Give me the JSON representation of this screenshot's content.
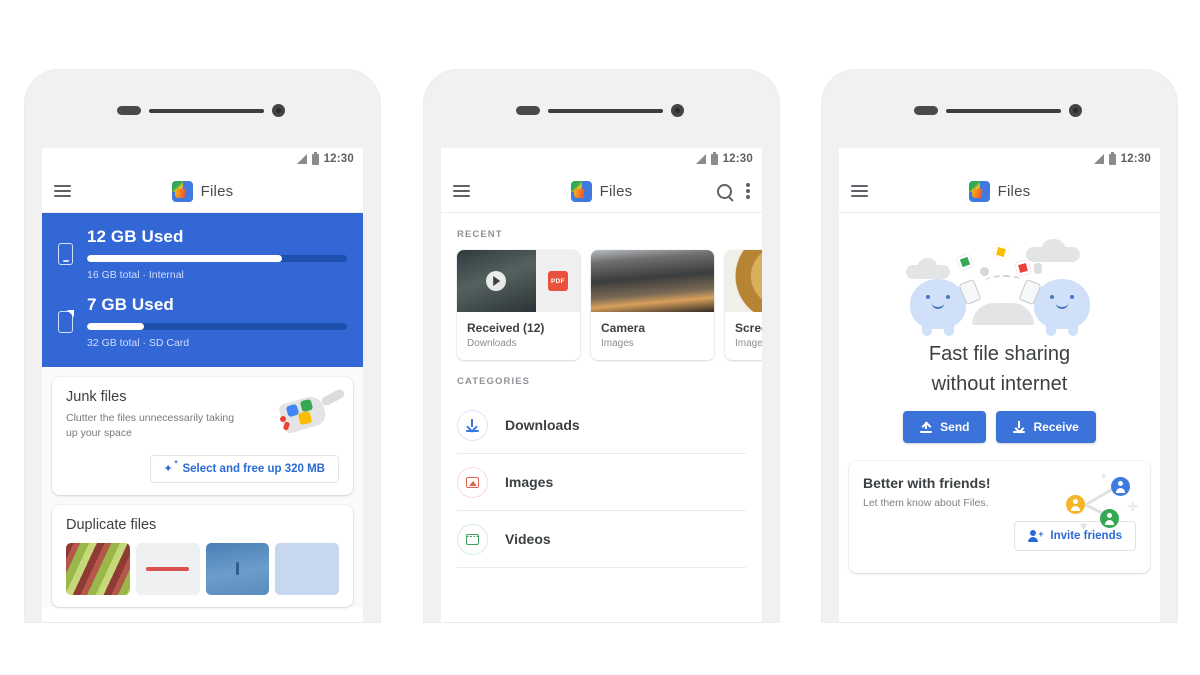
{
  "status_bar": {
    "time": "12:30",
    "signal_icon": "signal-icon",
    "battery_icon": "battery-icon"
  },
  "app": {
    "name": "Files",
    "logo_icon": "files-logo-icon",
    "menu_icon": "hamburger-menu-icon"
  },
  "colors": {
    "primary_blue": "#3367d6",
    "button_blue": "#3b73db",
    "link_blue": "#2b6ad4",
    "track_blue": "#1f4fad"
  },
  "screen1": {
    "storage": [
      {
        "icon": "phone-storage-icon",
        "title": "12 GB Used",
        "subtitle": "16 GB total · Internal",
        "used_gb": 12,
        "total_gb": 16,
        "percent": 75
      },
      {
        "icon": "sd-card-icon",
        "title": "7 GB Used",
        "subtitle": "32 GB total · SD Card",
        "used_gb": 7,
        "total_gb": 32,
        "percent": 22
      }
    ],
    "junk_card": {
      "title": "Junk files",
      "description": "Clutter the files unnecessarily taking up your space",
      "cta_label": "Select and free up 320 MB",
      "cta_icon": "sparkle-icon",
      "illustration": "dustpan-junk-illustration"
    },
    "duplicate_card": {
      "title": "Duplicate files",
      "thumbnails": [
        "grapes-thumbnail",
        "document-thumbnail",
        "sky-thumbnail",
        "blue-thumbnail"
      ]
    }
  },
  "screen2": {
    "search_icon": "search-icon",
    "overflow_icon": "more-vert-icon",
    "recent_label": "RECENT",
    "recent": [
      {
        "name": "Received (12)",
        "sub": "Downloads",
        "thumb": "video-pdf-thumbnail",
        "badge": "PDF"
      },
      {
        "name": "Camera",
        "sub": "Images",
        "thumb": "sunset-thumbnail"
      },
      {
        "name": "Screen",
        "sub": "Images",
        "thumb": "food-thumbnail"
      }
    ],
    "categories_label": "CATEGORIES",
    "categories": [
      {
        "name": "Downloads",
        "icon": "download-icon",
        "color": "#3b78e7"
      },
      {
        "name": "Images",
        "icon": "image-icon",
        "color": "#e06552"
      },
      {
        "name": "Videos",
        "icon": "video-icon",
        "color": "#3f9c5d"
      }
    ]
  },
  "screen3": {
    "illustration": "two-blobs-sharing-files-illustration",
    "hero_line1": "Fast file sharing",
    "hero_line2": "without internet",
    "send_label": "Send",
    "send_icon": "upload-icon",
    "receive_label": "Receive",
    "receive_icon": "download-icon",
    "friends_card": {
      "title": "Better with friends!",
      "subtitle": "Let them know about Files.",
      "cta_label": "Invite friends",
      "cta_icon": "person-add-icon",
      "illustration": "connected-avatars-illustration"
    }
  }
}
